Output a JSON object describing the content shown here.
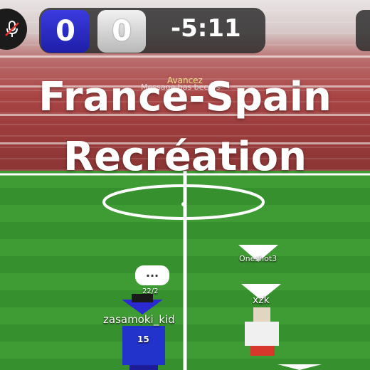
{
  "hud": {
    "home_score": "0",
    "away_score": "0",
    "timer": "-5:11",
    "home_color": "#2626c9",
    "away_color": "#d9d9d9"
  },
  "icons": {
    "mic": "muted-microphone-icon"
  },
  "overlay": {
    "title_line1": "France-Spain",
    "title_line2": "Recréation"
  },
  "chat": {
    "system_label": "Avancez",
    "message": "Message has been s"
  },
  "players": [
    {
      "name": "Oneshot3"
    },
    {
      "name": "xzk"
    },
    {
      "name": "zasamoki_kid"
    },
    {
      "name": "22/2"
    }
  ],
  "jersey_number": "15",
  "chat_bubble": "..."
}
